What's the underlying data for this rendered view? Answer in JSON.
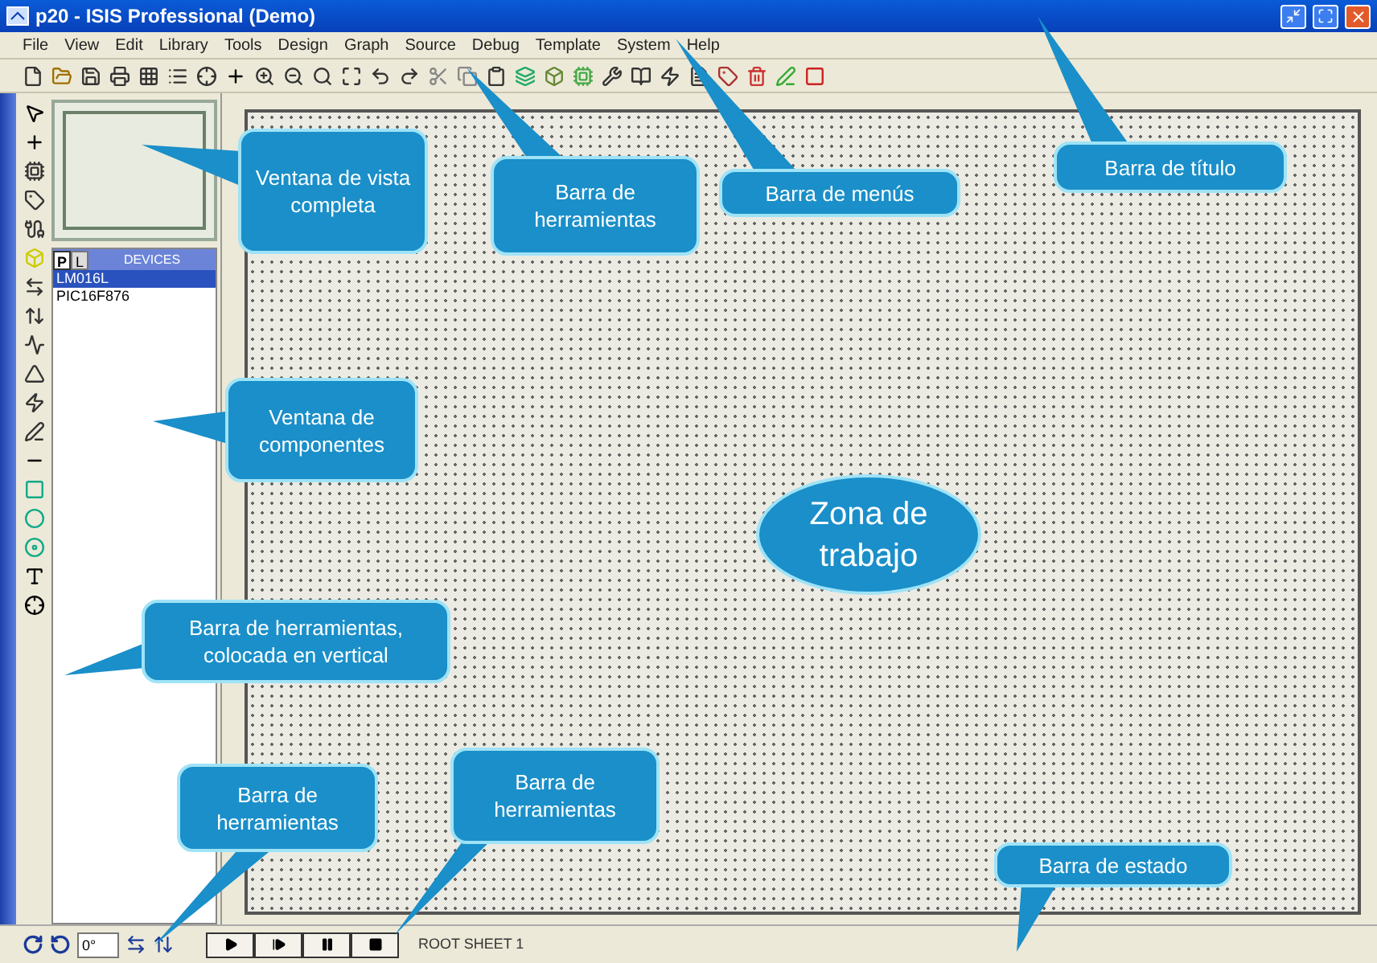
{
  "window": {
    "title": "p20 - ISIS Professional (Demo)"
  },
  "menu": [
    "File",
    "View",
    "Edit",
    "Library",
    "Tools",
    "Design",
    "Graph",
    "Source",
    "Debug",
    "Template",
    "System",
    "Help"
  ],
  "devices_panel": {
    "tabs": [
      {
        "label": "P",
        "selected": true
      },
      {
        "label": "L",
        "selected": false
      }
    ],
    "title": "DEVICES",
    "items": [
      {
        "label": "LM016L",
        "selected": true
      },
      {
        "label": "PIC16F876",
        "selected": false
      }
    ]
  },
  "rotation_field": {
    "value": "0°"
  },
  "status_bar": {
    "sheet": "ROOT SHEET 1"
  },
  "callouts": [
    {
      "kind": "bubble",
      "text": "Ventana de vista completa"
    },
    {
      "kind": "bubble",
      "text": "Barra de herramientas"
    },
    {
      "kind": "bubble",
      "text": "Barra de menús"
    },
    {
      "kind": "bubble",
      "text": "Barra de título"
    },
    {
      "kind": "bubble",
      "text": "Ventana de componentes"
    },
    {
      "kind": "ellipse",
      "text": "Zona de trabajo"
    },
    {
      "kind": "bubble",
      "text": "Barra de herramientas, colocada en vertical"
    },
    {
      "kind": "bubble",
      "text": "Barra de herramientas"
    },
    {
      "kind": "bubble",
      "text": "Barra de herramientas"
    },
    {
      "kind": "bubble",
      "text": "Barra de estado"
    }
  ]
}
